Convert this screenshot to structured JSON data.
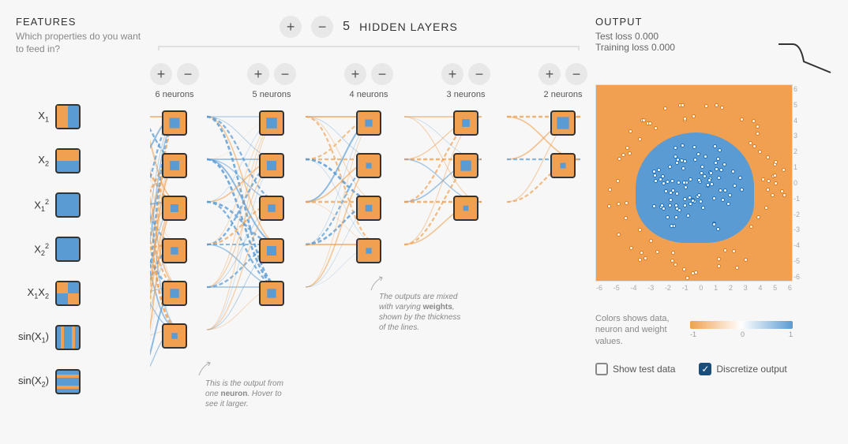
{
  "features": {
    "title": "FEATURES",
    "subtitle": "Which properties do you want to feed in?",
    "items": [
      {
        "label": "X₁",
        "active": true
      },
      {
        "label": "X₂",
        "active": true
      },
      {
        "label": "X₁²",
        "active": true
      },
      {
        "label": "X₂²",
        "active": true
      },
      {
        "label": "X₁X₂",
        "active": true
      },
      {
        "label": "sin(X₁)",
        "active": true
      },
      {
        "label": "sin(X₂)",
        "active": true
      }
    ]
  },
  "hidden_layers": {
    "count": "5",
    "title": "HIDDEN LAYERS",
    "layers": [
      {
        "neurons": 6,
        "label": "6 neurons"
      },
      {
        "neurons": 5,
        "label": "5 neurons"
      },
      {
        "neurons": 4,
        "label": "4 neurons"
      },
      {
        "neurons": 3,
        "label": "3 neurons"
      },
      {
        "neurons": 2,
        "label": "2 neurons"
      }
    ]
  },
  "annotations": {
    "neuron": "This is the output from one neuron. Hover to see it larger.",
    "weights": "The outputs are mixed with varying weights, shown by the thickness of the lines."
  },
  "output": {
    "title": "OUTPUT",
    "test_loss_label": "Test loss",
    "test_loss_value": "0.000",
    "train_loss_label": "Training loss",
    "train_loss_value": "0.000",
    "axis_ticks_y": [
      "6",
      "5",
      "4",
      "3",
      "2",
      "1",
      "0",
      "-1",
      "-2",
      "-3",
      "-4",
      "-5",
      "-6"
    ],
    "axis_ticks_x": [
      "-6",
      "-5",
      "-4",
      "-3",
      "-2",
      "-1",
      "0",
      "1",
      "2",
      "3",
      "4",
      "5",
      "6"
    ],
    "legend_text": "Colors shows data, neuron and weight values.",
    "gradient_labels": [
      "-1",
      "0",
      "1"
    ],
    "checkbox_test": "Show test data",
    "checkbox_discretize": "Discretize output",
    "checkbox_test_checked": false,
    "checkbox_discretize_checked": true
  },
  "colors": {
    "blue": "#5a9bd4",
    "orange": "#f0a050"
  },
  "buttons": {
    "plus": "+",
    "minus": "−"
  }
}
